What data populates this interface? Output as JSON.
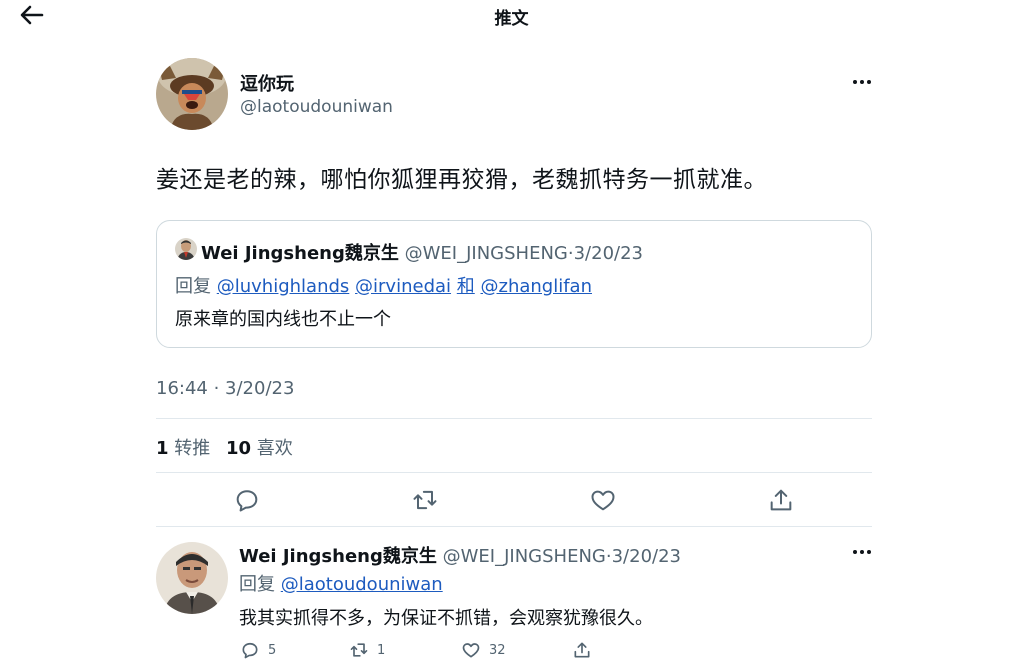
{
  "header": {
    "back_icon": "arrow-left-icon",
    "title": "推文"
  },
  "tweet": {
    "author_name": "逗你玩",
    "author_handle": "@laotoudouniwan",
    "text": "姜还是老的辣，哪怕你狐狸再狡猾，老魏抓特务一抓就准。",
    "timestamp": "16:44 · 3/20/23",
    "stats": {
      "retweets_count": "1",
      "retweets_label": "转推",
      "likes_count": "10",
      "likes_label": "喜欢"
    },
    "actions": [
      "reply-icon",
      "retweet-icon",
      "like-icon",
      "share-icon"
    ]
  },
  "quoted_tweet": {
    "author_name": "Wei Jingsheng魏京生",
    "author_handle": "@WEI_JINGSHENG",
    "date": "3/20/23",
    "reply_label": "回复",
    "mentions": [
      "@luvhighlands",
      "@irvinedai",
      "和",
      "@zhanglifan"
    ],
    "text": "原来章的国内线也不止一个"
  },
  "reply_tweet": {
    "author_name": "Wei Jingsheng魏京生",
    "author_handle": "@WEI_JINGSHENG",
    "date": "3/20/23",
    "reply_label": "回复",
    "reply_mention": "@laotoudouniwan",
    "text": "我其实抓得不多，为保证不抓错，会观察犹豫很久。",
    "counts": {
      "replies": "5",
      "retweets": "1",
      "likes": "32"
    }
  },
  "colors": {
    "text": "#0f1419",
    "secondary": "#536471",
    "link": "#1d5bbf",
    "border": "#cfd9de"
  }
}
